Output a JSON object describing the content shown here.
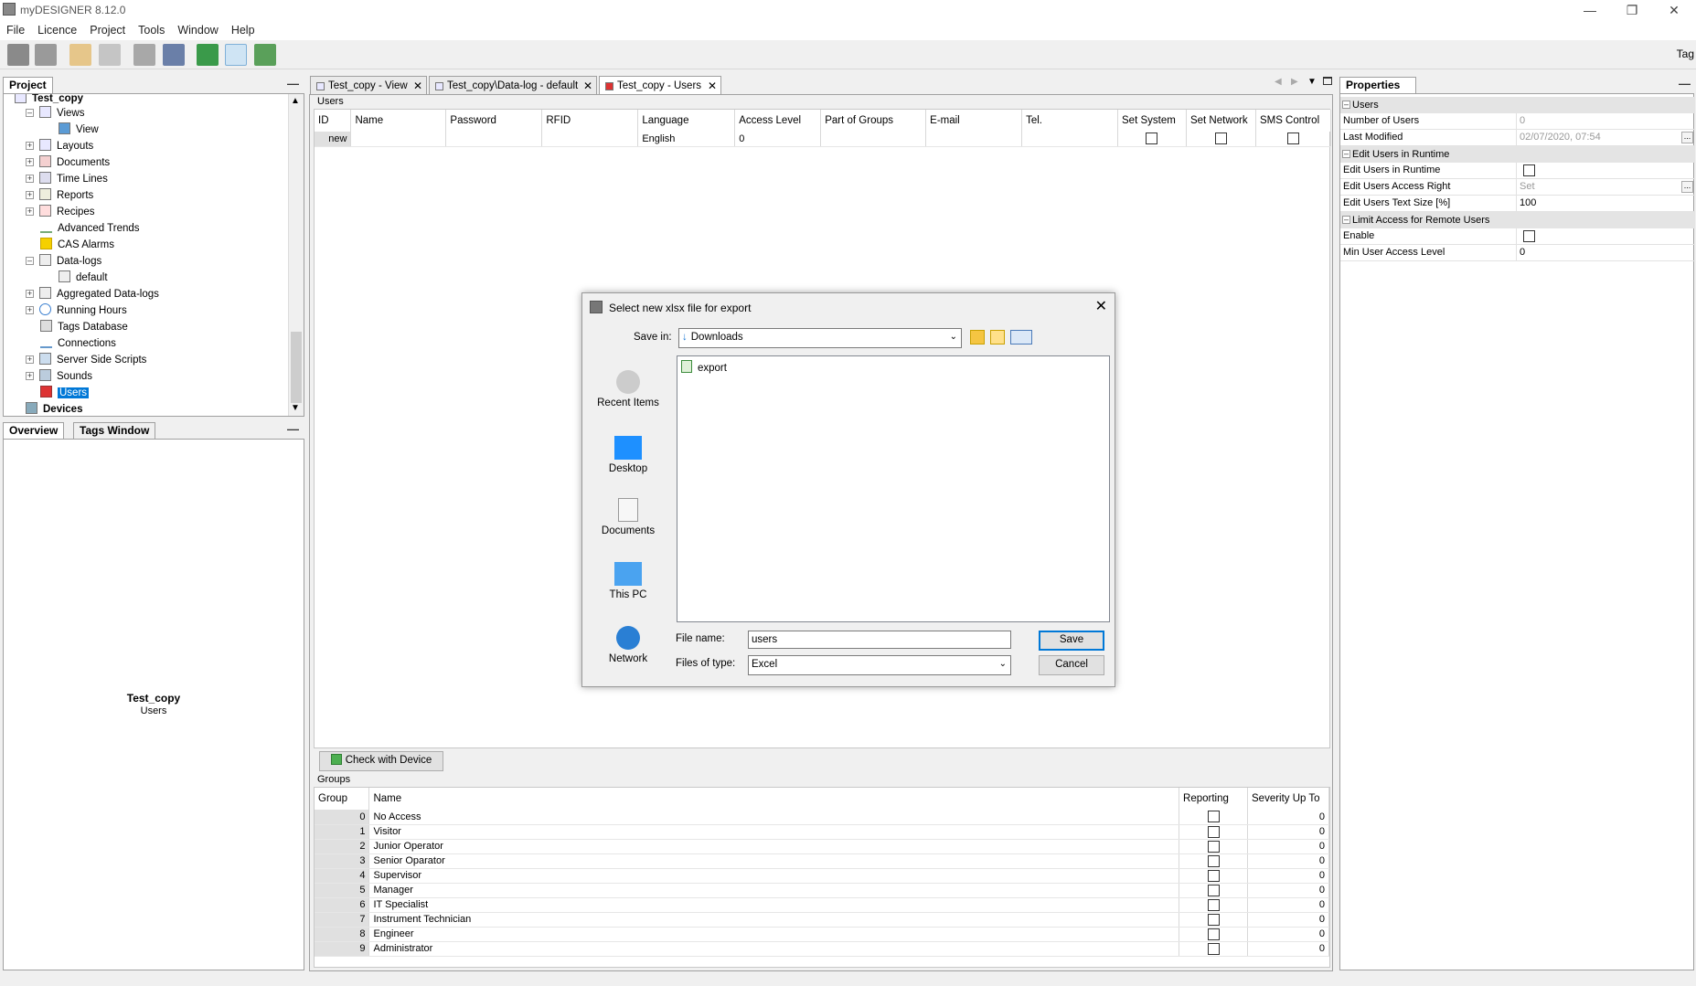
{
  "app": {
    "title": "myDESIGNER 8.12.0",
    "toolbar_right_label": "Tag"
  },
  "menu": [
    "File",
    "Licence",
    "Project",
    "Tools",
    "Window",
    "Help"
  ],
  "project_panel": {
    "tab_label": "Project",
    "items": [
      {
        "label": "Test_copy"
      },
      {
        "label": "Views"
      },
      {
        "label": "View"
      },
      {
        "label": "Layouts"
      },
      {
        "label": "Documents"
      },
      {
        "label": "Time Lines"
      },
      {
        "label": "Reports"
      },
      {
        "label": "Recipes"
      },
      {
        "label": "Advanced Trends"
      },
      {
        "label": "CAS Alarms"
      },
      {
        "label": "Data-logs"
      },
      {
        "label": "default"
      },
      {
        "label": "Aggregated Data-logs"
      },
      {
        "label": "Running Hours"
      },
      {
        "label": "Tags Database"
      },
      {
        "label": "Connections"
      },
      {
        "label": "Server Side Scripts"
      },
      {
        "label": "Sounds"
      },
      {
        "label": "Users"
      },
      {
        "label": "Devices"
      }
    ]
  },
  "overview_panel": {
    "tab_overview": "Overview",
    "tab_tags": "Tags Window",
    "title": "Test_copy",
    "subtitle": "Users"
  },
  "doc_tabs": [
    {
      "label": "Test_copy - View"
    },
    {
      "label": "Test_copy\\Data-log - default"
    },
    {
      "label": "Test_copy - Users"
    }
  ],
  "users": {
    "section_label": "Users",
    "columns": [
      "ID",
      "Name",
      "Password",
      "RFID",
      "Language",
      "Access Level",
      "Part of Groups",
      "E-mail",
      "Tel.",
      "Set System",
      "Set Network",
      "SMS Control"
    ],
    "new_row": {
      "id": "new",
      "language": "English",
      "access_level": "0"
    }
  },
  "check_button": "Check with Device",
  "groups": {
    "section_label": "Groups",
    "columns": [
      "Group",
      "Name",
      "Reporting",
      "Severity Up To"
    ],
    "rows": [
      {
        "id": "0",
        "name": "No Access",
        "sev": "0"
      },
      {
        "id": "1",
        "name": "Visitor",
        "sev": "0"
      },
      {
        "id": "2",
        "name": "Junior Operator",
        "sev": "0"
      },
      {
        "id": "3",
        "name": "Senior Oparator",
        "sev": "0"
      },
      {
        "id": "4",
        "name": "Supervisor",
        "sev": "0"
      },
      {
        "id": "5",
        "name": "Manager",
        "sev": "0"
      },
      {
        "id": "6",
        "name": "IT Specialist",
        "sev": "0"
      },
      {
        "id": "7",
        "name": "Instrument Technician",
        "sev": "0"
      },
      {
        "id": "8",
        "name": "Engineer",
        "sev": "0"
      },
      {
        "id": "9",
        "name": "Administrator",
        "sev": "0"
      }
    ]
  },
  "properties": {
    "tab_label": "Properties",
    "cat_users": "Users",
    "number_of_users_k": "Number of Users",
    "number_of_users_v": "0",
    "last_modified_k": "Last Modified",
    "last_modified_v": "02/07/2020, 07:54",
    "cat_runtime": "Edit Users in Runtime",
    "edit_runtime_k": "Edit Users in Runtime",
    "edit_access_k": "Edit Users Access Right",
    "edit_access_v": "Set",
    "edit_text_k": "Edit Users Text Size [%]",
    "edit_text_v": "100",
    "cat_remote": "Limit Access for Remote Users",
    "enable_k": "Enable",
    "min_level_k": "Min User Access Level",
    "min_level_v": "0"
  },
  "dialog": {
    "title": "Select new xlsx file for export",
    "save_in_label": "Save in:",
    "save_in_value": "Downloads",
    "places": [
      "Recent Items",
      "Desktop",
      "Documents",
      "This PC",
      "Network"
    ],
    "files": [
      "export"
    ],
    "file_name_label": "File name:",
    "file_name_value": "users",
    "file_type_label": "Files of type:",
    "file_type_value": "Excel",
    "save": "Save",
    "cancel": "Cancel"
  }
}
